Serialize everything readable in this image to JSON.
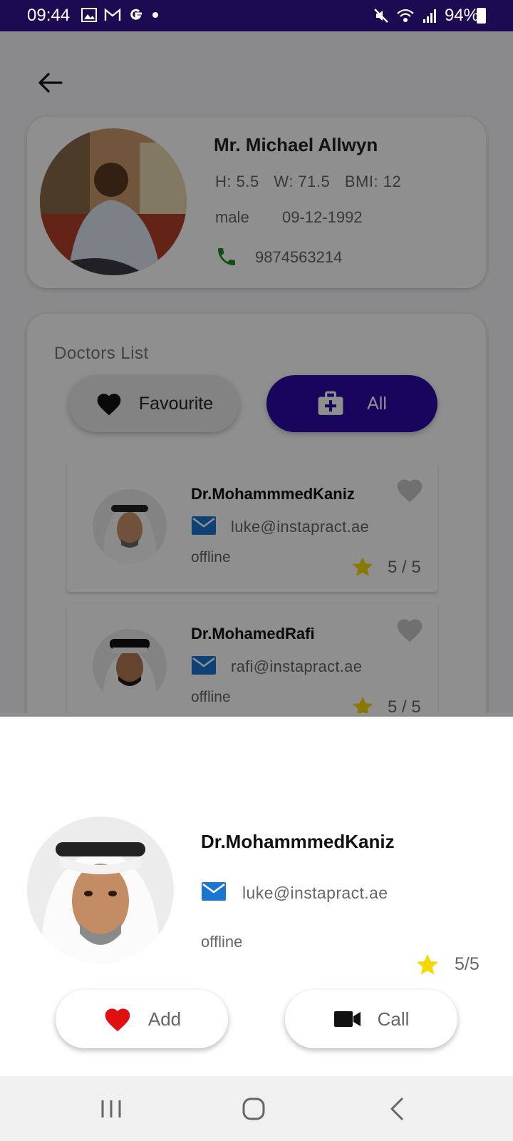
{
  "status_bar": {
    "time": "09:44",
    "battery": "94%",
    "icons": [
      "gallery-icon",
      "gmail-icon",
      "google-icon",
      "dot-icon",
      "mute-icon",
      "wifi-icon",
      "signal-icon",
      "battery-icon"
    ]
  },
  "patient": {
    "name": "Mr. Michael Allwyn",
    "height": "H: 5.5",
    "weight": "W: 71.5",
    "bmi": "BMI: 12",
    "gender": "male",
    "dob": "09-12-1992",
    "phone": "9874563214"
  },
  "doctors_list": {
    "title": "Doctors List",
    "favourite_label": "Favourite",
    "all_label": "All",
    "items": [
      {
        "name": "Dr.MohammmedKaniz",
        "email": "luke@instapract.ae",
        "status": "offline",
        "rating": "5 / 5"
      },
      {
        "name": "Dr.MohamedRafi",
        "email": "rafi@instapract.ae",
        "status": "offline",
        "rating": "5 / 5"
      }
    ]
  },
  "sheet": {
    "name": "Dr.MohammmedKaniz",
    "email": "luke@instapract.ae",
    "status": "offline",
    "rating": "5/5",
    "add_label": "Add",
    "call_label": "Call"
  },
  "colors": {
    "status_bar": "#1c0a52",
    "accent": "#2a0aa8",
    "phone_green": "#1e8a1e",
    "mail_blue": "#1976d2",
    "star_yellow": "#f5d800",
    "heart_red": "#e01010"
  }
}
